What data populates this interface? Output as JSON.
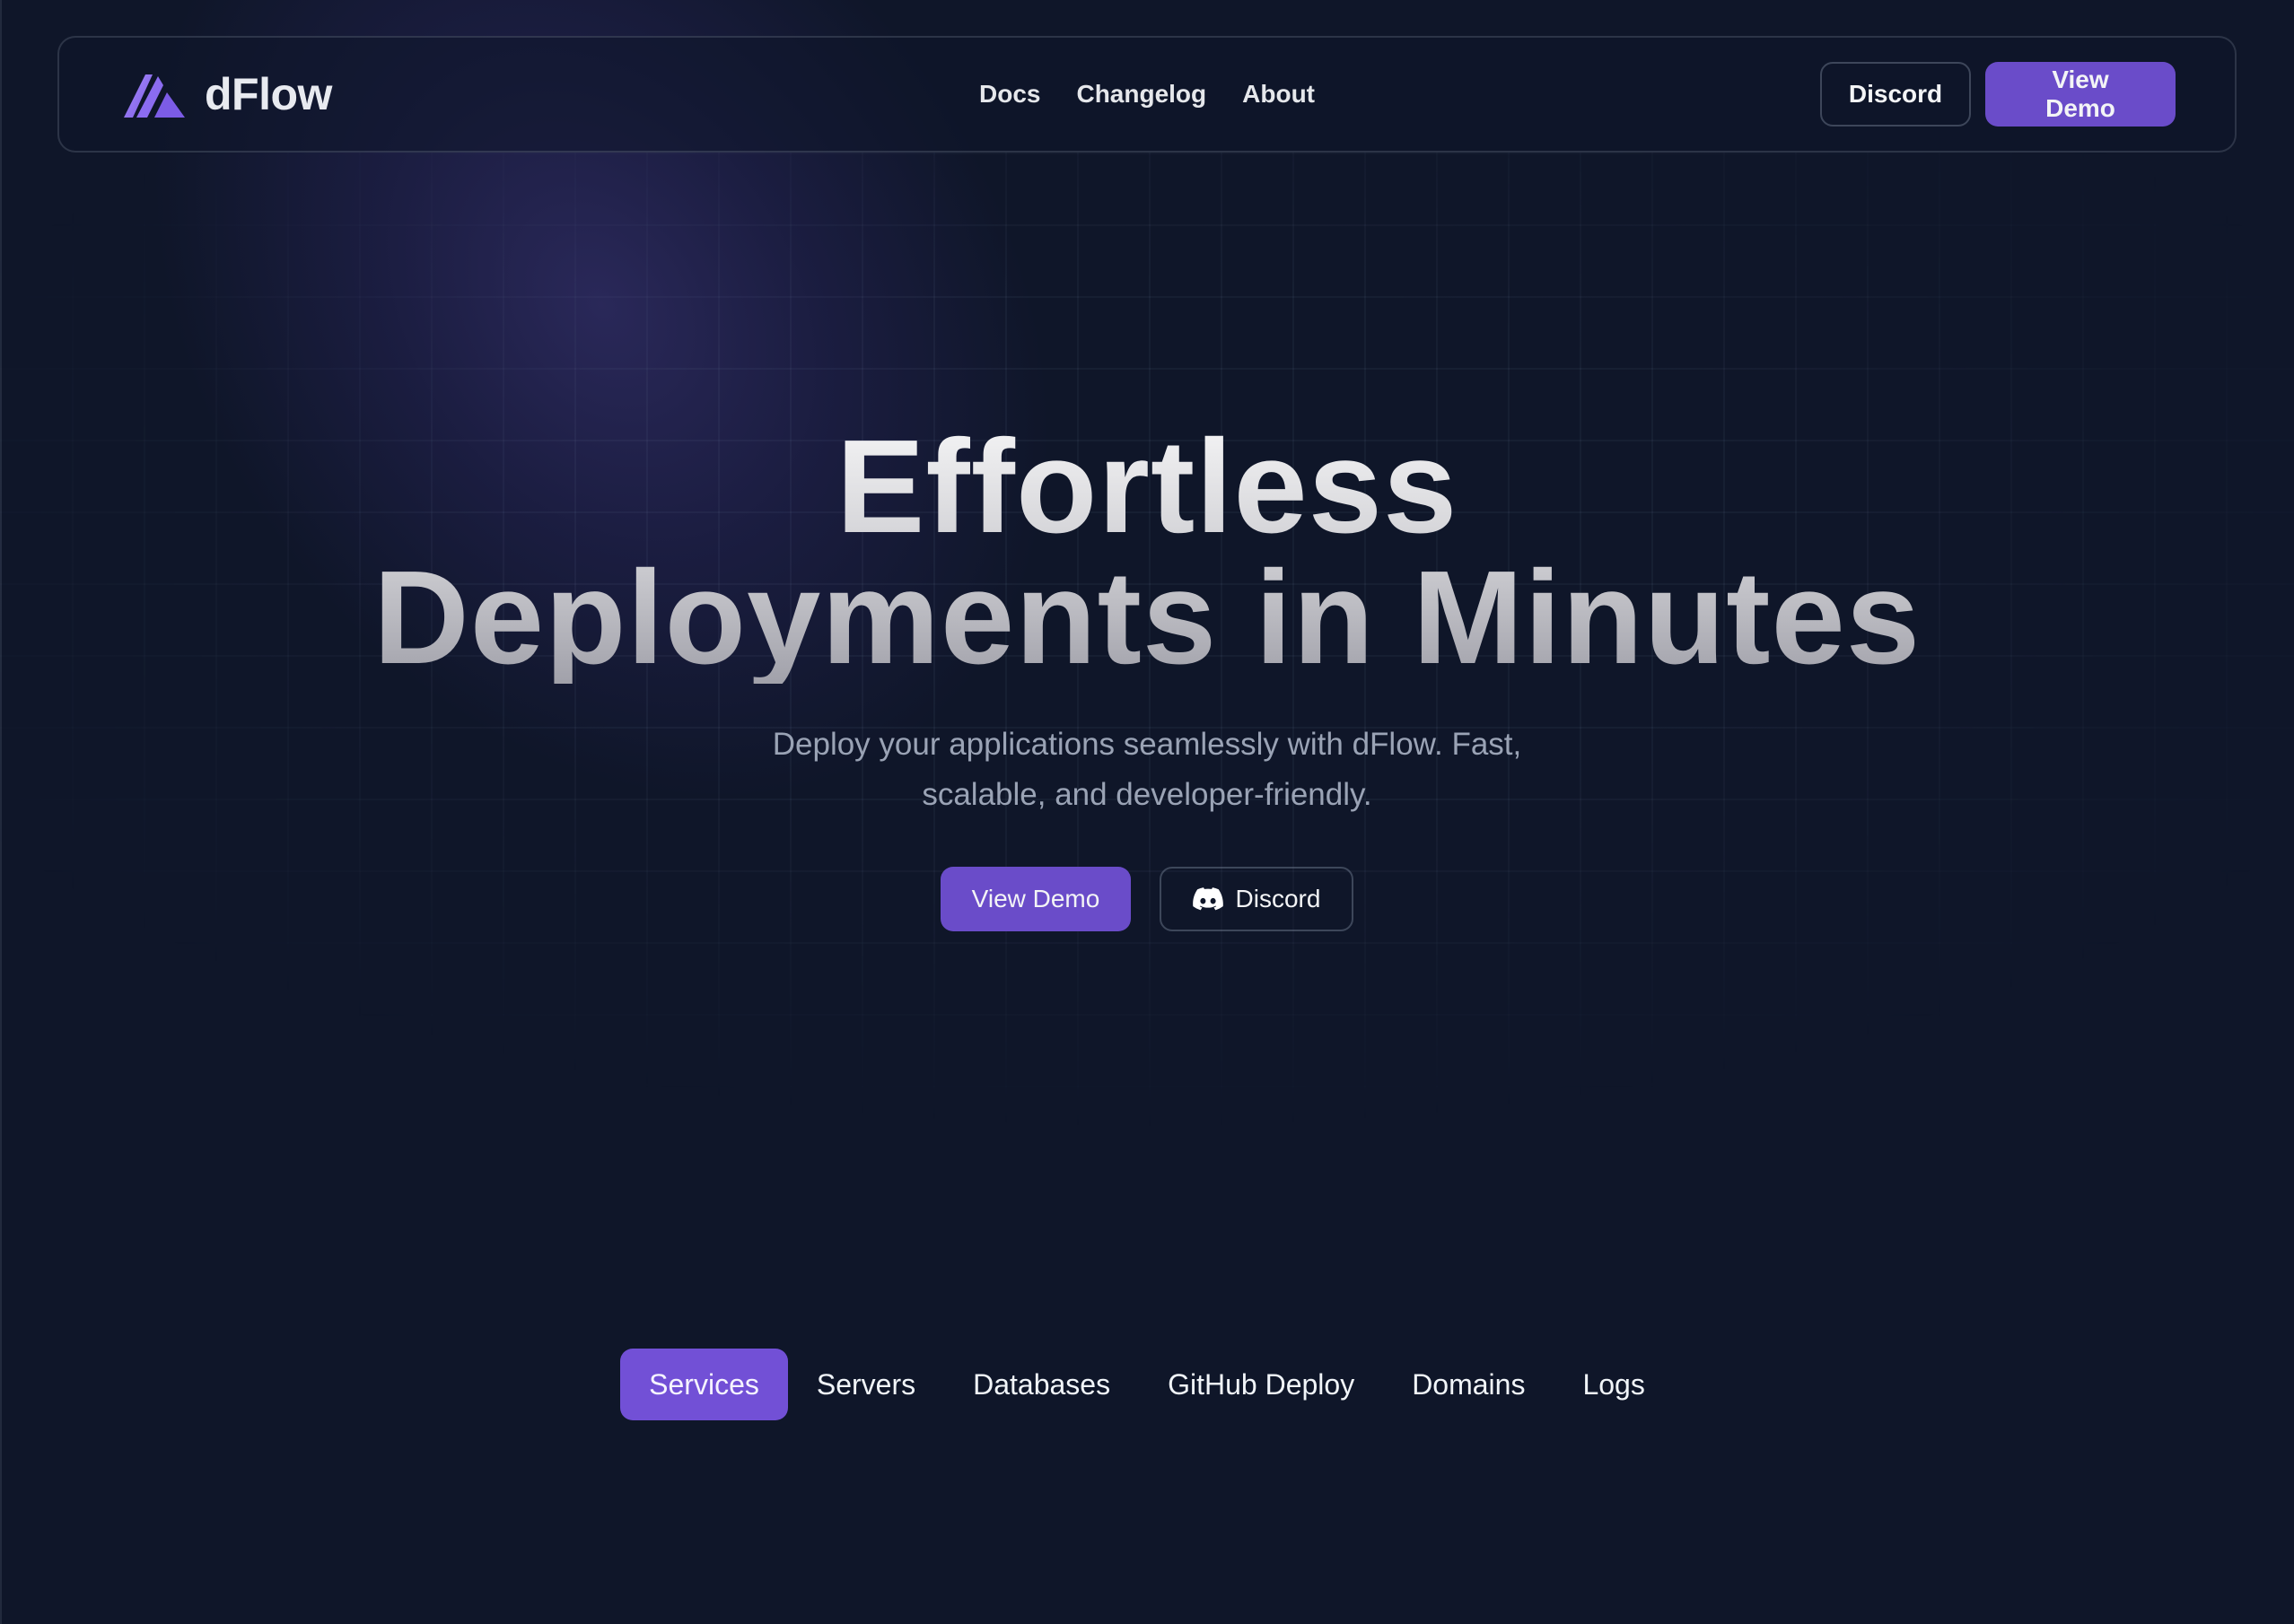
{
  "colors": {
    "background": "#0f1629",
    "accent": "#6a4cc9",
    "accent_tab": "#7250d6",
    "text": "#e5e7eb",
    "muted_text": "#9aa3b5"
  },
  "navbar": {
    "brand": {
      "name": "dFlow",
      "logo_icon": "dflow-logo-icon"
    },
    "links": [
      {
        "label": "Docs"
      },
      {
        "label": "Changelog"
      },
      {
        "label": "About"
      }
    ],
    "discord_label": "Discord",
    "demo_label": "View Demo"
  },
  "hero": {
    "title_line1": "Effortless",
    "title_line2": "Deployments in Minutes",
    "subtitle": "Deploy your applications seamlessly with dFlow. Fast, scalable, and developer-friendly.",
    "primary_label": "View Demo",
    "secondary_label": "Discord",
    "secondary_icon": "discord-icon"
  },
  "tabs": {
    "active_index": 0,
    "items": [
      {
        "label": "Services"
      },
      {
        "label": "Servers"
      },
      {
        "label": "Databases"
      },
      {
        "label": "GitHub Deploy"
      },
      {
        "label": "Domains"
      },
      {
        "label": "Logs"
      }
    ]
  }
}
